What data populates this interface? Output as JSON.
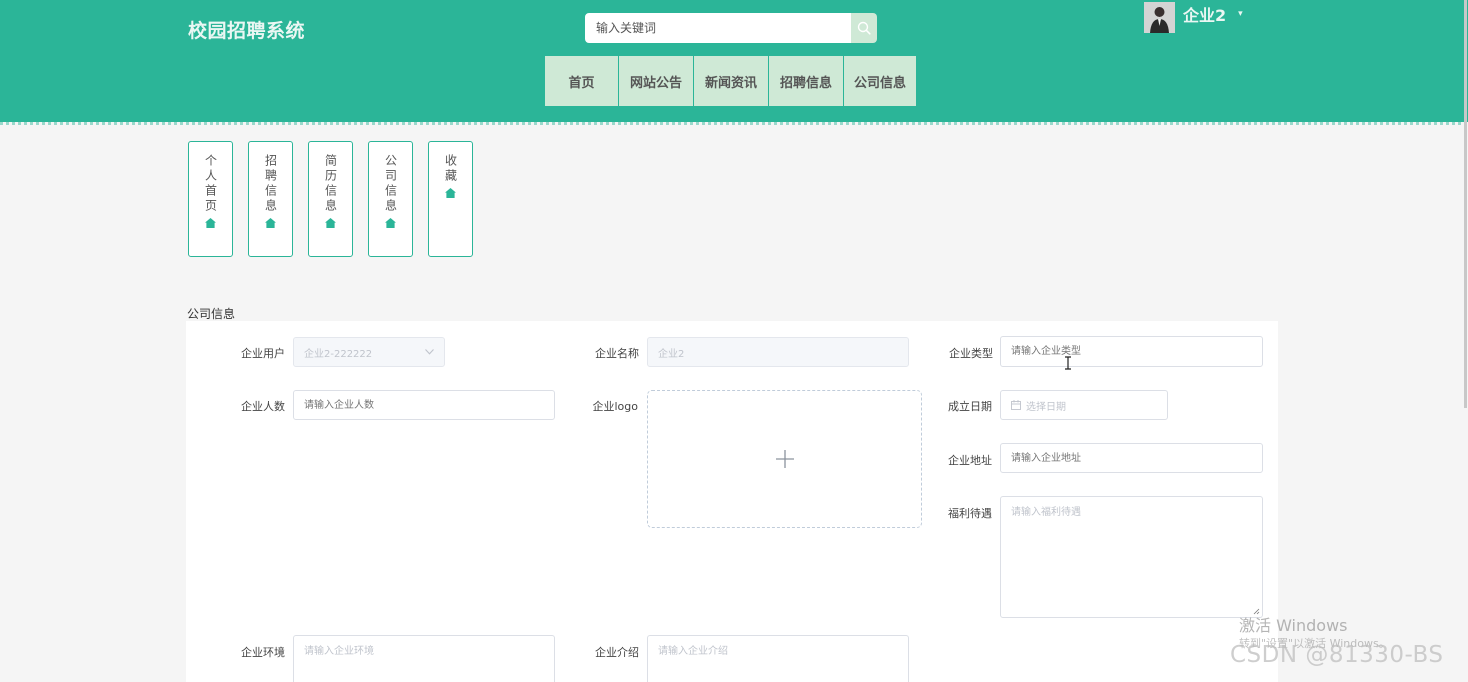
{
  "header": {
    "site_title": "校园招聘系统",
    "search_placeholder": "输入关键词",
    "user_name": "企业2",
    "user_caret": "▾",
    "icons": {
      "search": "search-icon",
      "caret": "caret-down-icon"
    }
  },
  "nav": {
    "items": [
      {
        "label": "首页"
      },
      {
        "label": "网站公告"
      },
      {
        "label": "新闻资讯"
      },
      {
        "label": "招聘信息"
      },
      {
        "label": "公司信息"
      }
    ]
  },
  "side_menu": {
    "icon": "home-icon",
    "items": [
      {
        "label": "个人首页"
      },
      {
        "label": "招聘信息"
      },
      {
        "label": "简历信息"
      },
      {
        "label": "公司信息"
      },
      {
        "label": "收藏"
      }
    ]
  },
  "form": {
    "section_title": "公司信息",
    "fields": {
      "company_user": {
        "label": "企业用户",
        "value": "企业2-222222"
      },
      "company_name": {
        "label": "企业名称",
        "value": "企业2"
      },
      "company_type": {
        "label": "企业类型",
        "placeholder": "请输入企业类型"
      },
      "company_size": {
        "label": "企业人数",
        "placeholder": "请输入企业人数"
      },
      "company_logo": {
        "label": "企业logo"
      },
      "founded_date": {
        "label": "成立日期",
        "placeholder": "选择日期"
      },
      "company_address": {
        "label": "企业地址",
        "placeholder": "请输入企业地址"
      },
      "benefits": {
        "label": "福利待遇",
        "placeholder": "请输入福利待遇"
      },
      "environment": {
        "label": "企业环境",
        "placeholder": "请输入企业环境"
      },
      "introduction": {
        "label": "企业介绍",
        "placeholder": "请输入企业介绍"
      }
    }
  },
  "overlay": {
    "activate_title": "激活 Windows",
    "activate_sub": "转到\"设置\"以激活 Windows。",
    "csdn": "CSDN @81330-BS"
  },
  "colors": {
    "primary": "#2bb598",
    "nav_bg": "#cfe9d6",
    "page_bg": "#f5f5f5"
  }
}
